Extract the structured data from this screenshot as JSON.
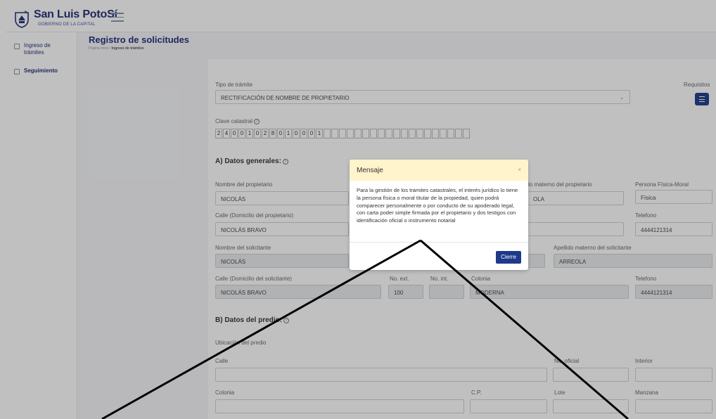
{
  "header": {
    "brand_title": "San Luis PotoSí",
    "brand_subtitle": "GOBIERNO DE LA CAPITAL"
  },
  "sidebar": {
    "items": [
      {
        "label": "Ingreso de trámites"
      },
      {
        "label": "Seguimiento"
      }
    ]
  },
  "page": {
    "title": "Registro de solicitudes",
    "breadcrumb_home": "Página inicio",
    "breadcrumb_sep": "/",
    "breadcrumb_current": "Ingreso de trámites"
  },
  "form": {
    "tipo_label": "Tipo de trámite",
    "tipo_value": "RECTIFICACIÓN DE NOMBRE DE PROPIETARIO",
    "requisitos_label": "Requisitos",
    "clave_label": "Clave catastral",
    "clave_digits": [
      "2",
      "4",
      "0",
      "0",
      "1",
      "0",
      "2",
      "8",
      "0",
      "1",
      "0",
      "0",
      "0",
      "1",
      "",
      "",
      "",
      "",
      "",
      "",
      "",
      "",
      "",
      "",
      "",
      "",
      "",
      "",
      "",
      "",
      "",
      "",
      ""
    ],
    "section_a": "A) Datos generales:",
    "nombre_prop_label": "Nombre del propietario",
    "nombre_prop_value": "NICOLÁS",
    "apellido_mat_prop_label": "lo materno del propietario",
    "apellido_mat_prop_value": "OLA",
    "persona_label": "Persona Física-Moral",
    "persona_value": "Física",
    "calle_prop_label": "Calle (Domicilio del propietario)",
    "calle_prop_value": "NICOLÁS BRAVO",
    "tel_prop_label": "Telefono",
    "tel_prop_value": "4444121314",
    "nombre_sol_label": "Nombre del solicitante",
    "nombre_sol_value": "NICOLÁS",
    "apellido_mat_sol_label": "Apellido materno del solicitante",
    "apellido_mat_sol_value": "ARREOLA",
    "calle_sol_label": "Calle (Domicilio del solicitante)",
    "calle_sol_value": "NICOLÁS BRAVO",
    "next_label": "No. ext.",
    "next_value": "100",
    "nint_label": "No. int.",
    "colonia_sol_label": "Colonia",
    "colonia_sol_value": "MODERNA",
    "tel_sol_label": "Telefono",
    "tel_sol_value": "4444121314",
    "section_b": "B) Datos del predio:",
    "ubicacion_label": "Ubicación del predio",
    "calle_label": "Calle",
    "noficial_label": "No. oficial",
    "interior_label": "Interior",
    "colonia_label": "Colonia",
    "cp_label": "C.P.",
    "lote_label": "Lote",
    "manzana_label": "Manzana"
  },
  "modal": {
    "title": "Mensaje",
    "close": "×",
    "body": "Para la gestión de los tramites catastrales, el interés jurídico lo tiene la persona física o moral titular de la propiedad, quien podrá comparecer personalmente o por conducto de su apoderado legal, con carta poder simple firmada por el propietario y dos testigos con identificación oficial o instrumento notarial",
    "button": "Cierre"
  },
  "icons": {
    "help": "?",
    "caret": "⌄"
  }
}
